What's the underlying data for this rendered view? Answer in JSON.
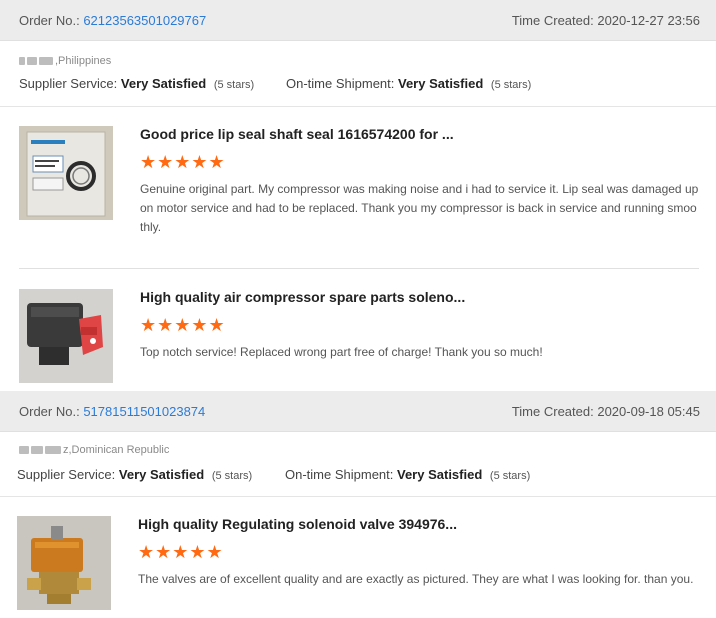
{
  "orders": [
    {
      "order_label": "Order No.:",
      "order_number": "62123563501029767",
      "time_label": "Time Created:",
      "time_value": "2020-12-27 23:56",
      "buyer_location": ",Philippines",
      "supplier_service_label": "Supplier Service:",
      "supplier_service_value": "Very Satisfied",
      "supplier_service_stars": "(5 stars)",
      "shipment_label": "On-time Shipment:",
      "shipment_value": "Very Satisfied",
      "shipment_stars": "(5 stars)",
      "reviews": [
        {
          "title": "Good price lip seal shaft seal 1616574200 for ...",
          "rating": 5,
          "stars": "★★★★★",
          "text": "Genuine original part. My compressor was making noise and i had to service it. Lip seal was damaged upon motor service and had to be replaced. Thank you my compressor is back in service and running smoothly."
        },
        {
          "title": "High quality air compressor spare parts soleno...",
          "rating": 5,
          "stars": "★★★★★",
          "text": "Top notch service! Replaced wrong part free of charge! Thank you so much!"
        }
      ]
    },
    {
      "order_label": "Order No.:",
      "order_number": "51781511501023874",
      "time_label": "Time Created:",
      "time_value": "2020-09-18 05:45",
      "buyer_location": "z,Dominican Republic",
      "supplier_service_label": "Supplier Service:",
      "supplier_service_value": "Very Satisfied",
      "supplier_service_stars": "(5 stars)",
      "shipment_label": "On-time Shipment:",
      "shipment_value": "Very Satisfied",
      "shipment_stars": "(5 stars)",
      "reviews": [
        {
          "title": "High quality Regulating solenoid valve 394976...",
          "rating": 5,
          "stars": "★★★★★",
          "text": "The valves are of excellent quality and are exactly as pictured.  They are what I was looking for.  than you."
        }
      ]
    }
  ],
  "colors": {
    "accent_link": "#2b7bd6",
    "star": "#ff6a13",
    "header_bg": "#ececec"
  },
  "icons": {
    "rating": "star-icon"
  }
}
